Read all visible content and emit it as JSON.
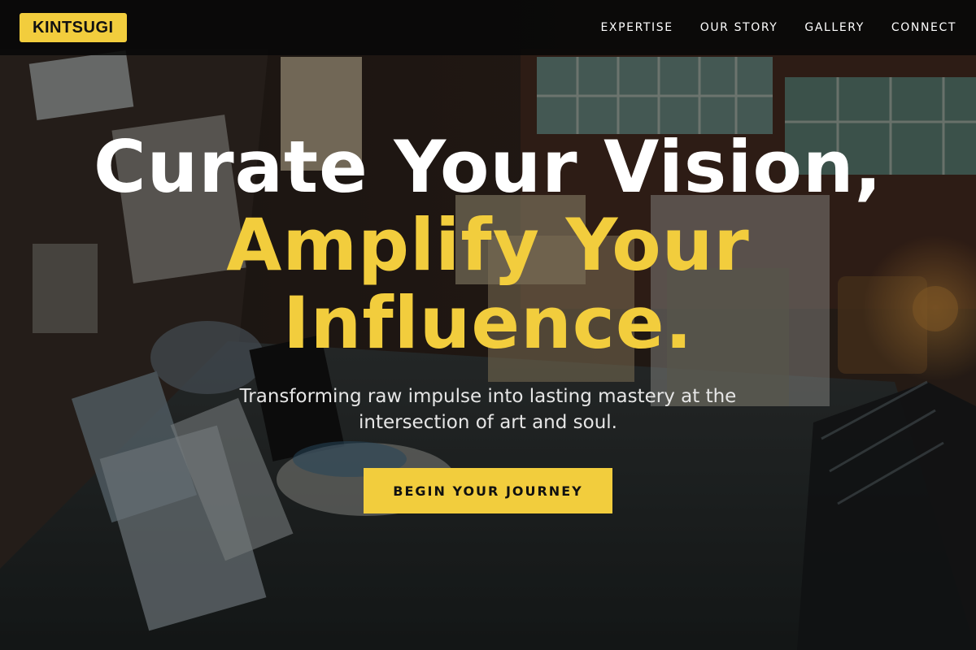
{
  "brand": {
    "logo_text": "KINTSUGI",
    "accent_color": "#f2cd3d"
  },
  "nav": {
    "items": [
      {
        "label": "EXPERTISE"
      },
      {
        "label": "OUR STORY"
      },
      {
        "label": "GALLERY"
      },
      {
        "label": "CONNECT"
      }
    ]
  },
  "hero": {
    "headline_line1": "Curate Your Vision,",
    "headline_line2": "Amplify Your",
    "headline_line3": "Influence.",
    "subtitle": "Transforming raw impulse into lasting mastery at the intersection of art and soul.",
    "cta_label": "BEGIN YOUR JOURNEY"
  }
}
